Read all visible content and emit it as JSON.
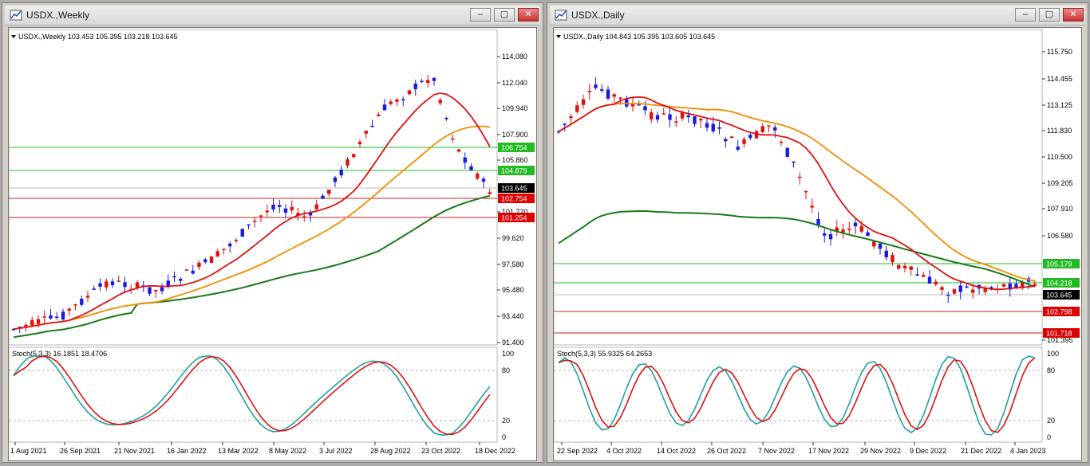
{
  "windows": [
    {
      "title": "USDX.,Weekly",
      "buttons": {
        "minimize": "–",
        "restore": "▢",
        "close": "✕"
      },
      "header": "USDX.,Weekly  103.453 105.395 103.218 103.645",
      "price_labels": [
        "114.080",
        "112.040",
        "109.940",
        "107.900",
        "105.860",
        "101.720",
        "99.620",
        "97.580",
        "95.480",
        "93.440",
        "91.400"
      ],
      "level_labels": [
        {
          "text": "106.754",
          "bg": "#22bb22",
          "color": "#ffffff"
        },
        {
          "text": "104.879",
          "bg": "#22bb22",
          "color": "#ffffff"
        },
        {
          "text": "103.645",
          "bg": "#000000",
          "color": "#ffffff"
        },
        {
          "text": "102.754",
          "bg": "#dd0000",
          "color": "#ffffff"
        },
        {
          "text": "101.254",
          "bg": "#dd0000",
          "color": "#ffffff"
        }
      ],
      "stoch_label": "Stoch(5,3,3) 16.1851 18.4706",
      "stoch_scale": [
        "100",
        "80",
        "20",
        "0"
      ],
      "date_labels": [
        "1 Aug 2021",
        "26 Sep 2021",
        "21 Nov 2021",
        "16 Jan 2022",
        "13 Mar 2022",
        "8 May 2022",
        "3 Jul 2022",
        "28 Aug 2022",
        "23 Oct 2022",
        "18 Dec 2022"
      ]
    },
    {
      "title": "USDX.,Daily",
      "buttons": {
        "minimize": "–",
        "restore": "▢",
        "close": "✕"
      },
      "header": "USDX.,Daily  104.843 105.395 103.605 103.645",
      "price_labels": [
        "115.750",
        "114.455",
        "113.125",
        "111.830",
        "110.500",
        "109.205",
        "107.910",
        "106.580",
        "101.395"
      ],
      "level_labels": [
        {
          "text": "105.179",
          "bg": "#22bb22",
          "color": "#ffffff"
        },
        {
          "text": "104.218",
          "bg": "#22bb22",
          "color": "#ffffff"
        },
        {
          "text": "103.645",
          "bg": "#000000",
          "color": "#ffffff"
        },
        {
          "text": "102.798",
          "bg": "#dd0000",
          "color": "#ffffff"
        },
        {
          "text": "101.718",
          "bg": "#dd0000",
          "color": "#ffffff"
        }
      ],
      "stoch_label": "Stoch(5,3,3) 55.9325 64.2653",
      "stoch_scale": [
        "100",
        "80",
        "20",
        "0"
      ],
      "date_labels": [
        "22 Sep 2022",
        "4 Oct 2022",
        "14 Oct 2022",
        "26 Oct 2022",
        "7 Nov 2022",
        "17 Nov 2022",
        "29 Nov 2022",
        "9 Dec 2022",
        "21 Dec 2022",
        "4 Jan 2023"
      ]
    }
  ],
  "colors": {
    "bull": "#1a1adf",
    "bear": "#e01010",
    "ma_red": "#e01010",
    "ma_orange": "#f08c00",
    "ma_green": "#1a7a1a",
    "stoch_main": "#20a0a0",
    "stoch_signal": "#e01010"
  }
}
